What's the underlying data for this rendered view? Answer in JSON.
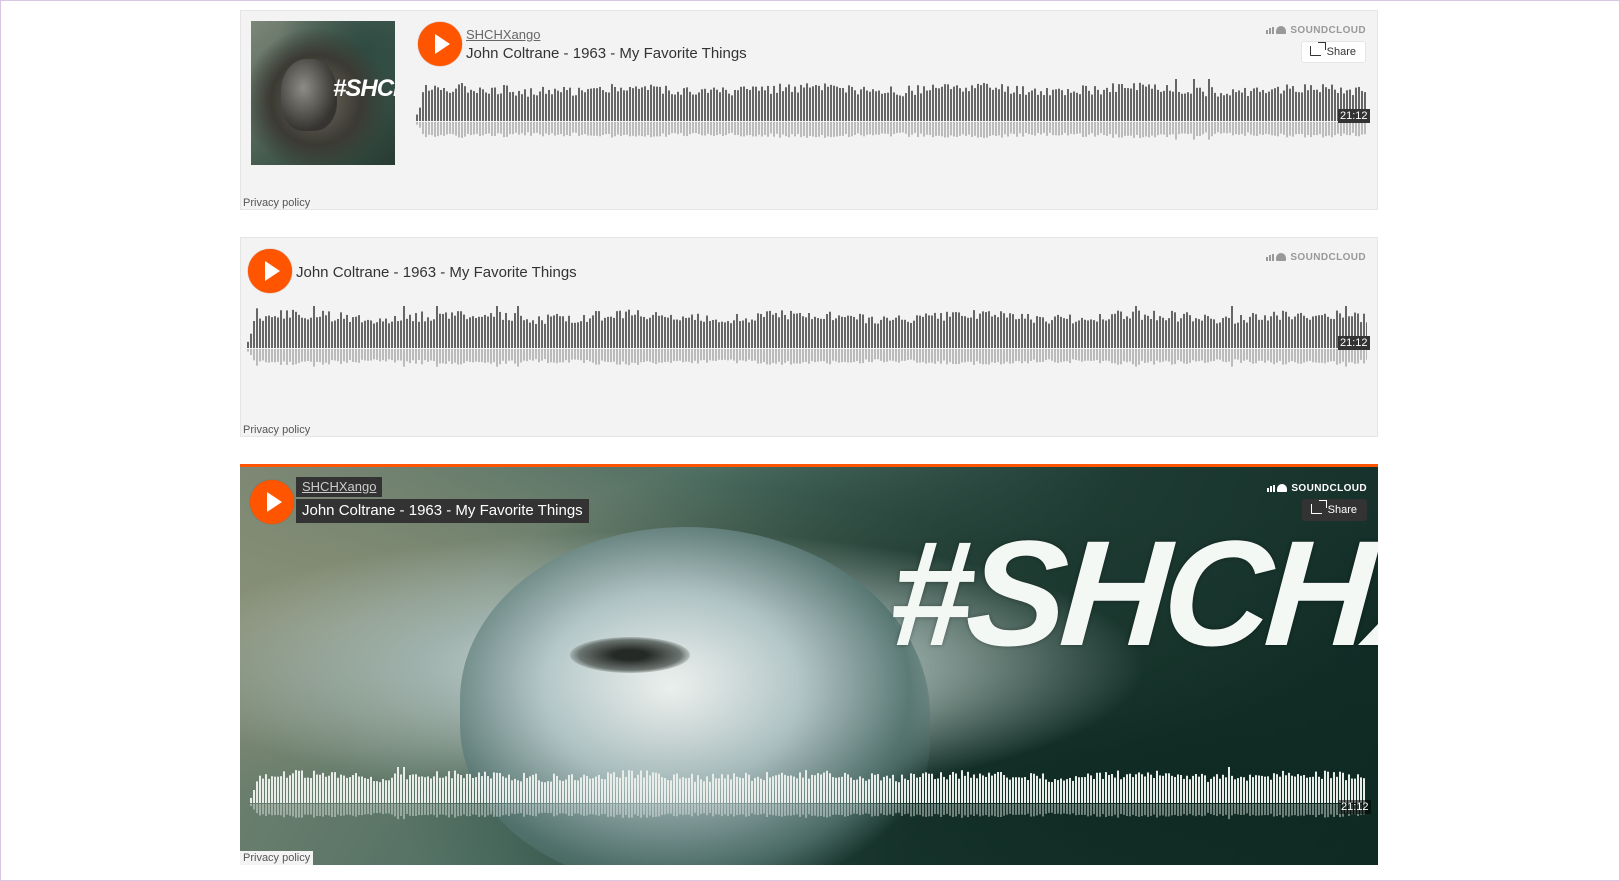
{
  "widgets": [
    {
      "username": "SHCHXango",
      "title": "John Coltrane - 1963 - My Favorite Things",
      "logo": "SOUNDCLOUD",
      "share": "Share",
      "duration": "21:12",
      "privacy": "Privacy policy",
      "artwork_tag": "#SHCHX"
    },
    {
      "title": "John Coltrane - 1963 - My Favorite Things",
      "logo": "SOUNDCLOUD",
      "duration": "21:12",
      "privacy": "Privacy policy"
    },
    {
      "username": "SHCHXango",
      "title": "John Coltrane - 1963 - My Favorite Things",
      "logo": "SOUNDCLOUD",
      "share": "Share",
      "duration": "21:12",
      "privacy": "Privacy policy",
      "artwork_tag": "#SHCHX"
    }
  ],
  "colors": {
    "accent": "#ff5500",
    "panel": "#f3f3f3",
    "wave_dark": "#666666",
    "wave_light": "#bbbbbb"
  },
  "icons": [
    "play-icon",
    "soundcloud-logo-icon",
    "share-icon"
  ]
}
